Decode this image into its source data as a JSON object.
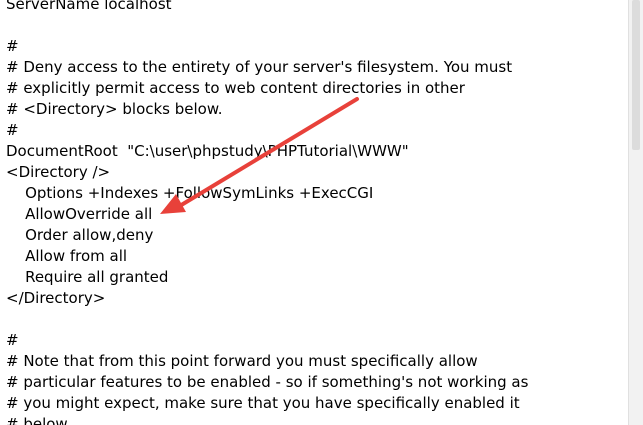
{
  "lines": [
    "ServerName localhost",
    "",
    "#",
    "# Deny access to the entirety of your server's filesystem. You must",
    "# explicitly permit access to web content directories in other",
    "# <Directory> blocks below.",
    "#",
    "DocumentRoot  \"C:\\user\\phpstudy\\PHPTutorial\\WWW\"",
    "<Directory />",
    "    Options +Indexes +FollowSymLinks +ExecCGI",
    "    AllowOverride all",
    "    Order allow,deny",
    "    Allow from all",
    "    Require all granted",
    "</Directory>",
    "",
    "#",
    "# Note that from this point forward you must specifically allow",
    "# particular features to be enabled - so if something's not working as",
    "# you might expect, make sure that you have specifically enabled it",
    "# below."
  ],
  "annotation": {
    "arrow_color": "#e8413a"
  }
}
